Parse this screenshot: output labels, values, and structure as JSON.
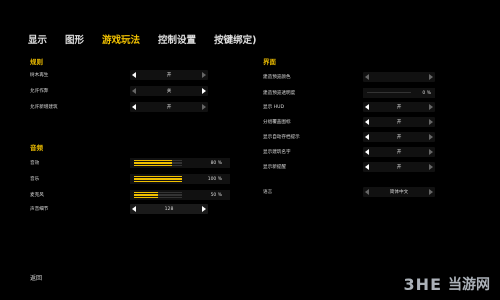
{
  "tabs": [
    "显示",
    "图形",
    "游戏玩法",
    "控制设置",
    "按键绑定)"
  ],
  "left": {
    "section1": "规则",
    "rules": [
      {
        "label": "树木再生",
        "value": "开"
      },
      {
        "label": "允许作弊",
        "value": "关"
      },
      {
        "label": "允许新增建筑",
        "value": "开"
      }
    ],
    "section2": "音频",
    "audio": [
      {
        "label": "音效",
        "value": "80 %",
        "level": 0.8
      },
      {
        "label": "音乐",
        "value": "100 %",
        "level": 1.0
      },
      {
        "label": "麦克风",
        "value": "50 %",
        "level": 0.5
      }
    ],
    "sound_row": {
      "label": "声音细节",
      "value": "128"
    }
  },
  "right": {
    "section": "界面",
    "rows": [
      {
        "label": "建造预览颜色",
        "value": ""
      },
      {
        "label": "建造预览透明度",
        "value": "0 %"
      },
      {
        "label": "显示 HUD",
        "value": "开"
      },
      {
        "label": "分组覆盖图标",
        "value": "开"
      },
      {
        "label": "显示自动存档提示",
        "value": "开"
      },
      {
        "label": "显示建筑名字",
        "value": "开"
      },
      {
        "label": "显示新提醒",
        "value": "开"
      },
      {
        "label": "语言",
        "value": "简体中文"
      }
    ]
  },
  "footer": {
    "back": "返回"
  },
  "watermark": {
    "logo": "3HE",
    "text": "当游网"
  },
  "colors": {
    "accent": "#f0c000",
    "background": "#000000"
  }
}
